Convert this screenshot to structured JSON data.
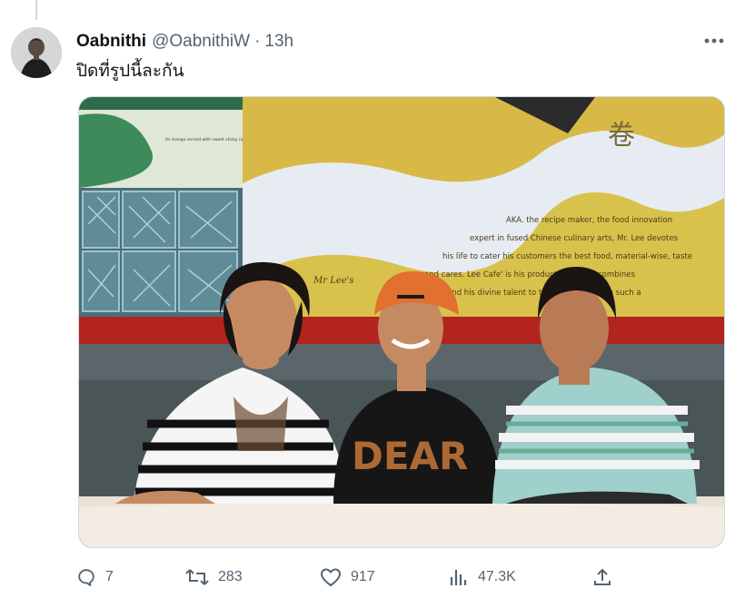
{
  "tweet": {
    "display_name": "Oabnithi",
    "handle": "@OabnithiW",
    "separator": "·",
    "time": "13h",
    "text": "ปิดที่รูปนี้ละกัน"
  },
  "media": {
    "restaurant_sign": {
      "chinese_char": "卷",
      "brand": "Mr Lee's",
      "lines": [
        "AKA. the recipe maker, the food innovation",
        "expert in fused Chinese culinary arts, Mr. Lee devotes",
        "his life to cater his customers the best food, material-wise, taste",
        "and cares. Lee Cafe' is his product where he combines",
        "passion and his divine talent to the good foods in a such a"
      ]
    },
    "poster_text": "its mango served with sweet sticky rice and topped with coconut cream"
  },
  "actions": {
    "reply_count": "7",
    "retweet_count": "283",
    "like_count": "917",
    "view_count": "47.3K"
  },
  "colors": {
    "text_primary": "#0f1419",
    "text_secondary": "#536471",
    "border": "#cfd9de"
  },
  "icons": {
    "more": "ellipsis-icon",
    "reply": "reply-icon",
    "retweet": "retweet-icon",
    "like": "heart-icon",
    "views": "views-icon",
    "share": "share-icon"
  }
}
